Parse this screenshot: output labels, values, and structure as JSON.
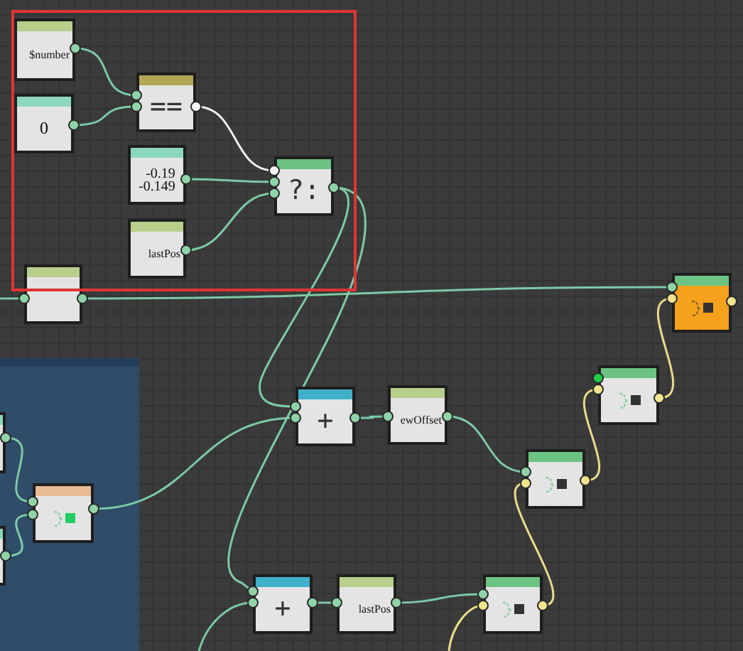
{
  "nodes": [
    {
      "kind": "value",
      "label": "$number",
      "color": "#b8cf8c"
    },
    {
      "kind": "value",
      "label": "0",
      "color": "#8cd8bc"
    },
    {
      "kind": "operator",
      "label": "==",
      "color": "#b3a554"
    },
    {
      "kind": "multi",
      "lines": [
        "-0.19",
        "-0.149"
      ],
      "color": "#8cd8bc"
    },
    {
      "kind": "value",
      "label": "lastPos",
      "color": "#b8cf8c"
    },
    {
      "kind": "operator",
      "label": "?:",
      "color": "#6cc383"
    },
    {
      "kind": "blank",
      "color": "#b8cf8c"
    },
    {
      "kind": "output",
      "color": "#6cc383"
    },
    {
      "kind": "operator",
      "label": "+",
      "color": "#3fb0c8"
    },
    {
      "kind": "value",
      "label": "ewOffset",
      "color": "#b8cf8c"
    },
    {
      "kind": "function",
      "color": "#6cc383"
    },
    {
      "kind": "function",
      "color": "#6cc383"
    },
    {
      "kind": "function",
      "color": "#6cc383"
    },
    {
      "kind": "operator",
      "label": "+",
      "color": "#3fb0c8"
    },
    {
      "kind": "value",
      "label": "lastPos",
      "color": "#b8cf8c"
    },
    {
      "kind": "function",
      "color": "#e8bb94"
    },
    {
      "kind": "blank",
      "color": "#8cd8bc"
    },
    {
      "kind": "blank",
      "color": "#8cd8bc"
    }
  ]
}
